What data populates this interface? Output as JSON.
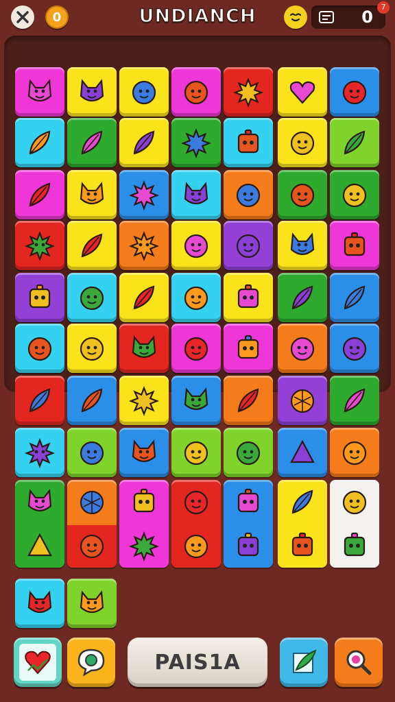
{
  "header": {
    "left_button_icon": "tools-icon",
    "coin_value": "0",
    "title": "UNDIANCH",
    "mascot_icon": "smiley-face-icon",
    "score_icon": "ticket-icon",
    "score_value": "0",
    "score_badge": "7"
  },
  "board": {
    "rows": 9,
    "columns": 7,
    "tile_colors": {
      "magenta": "#ee37d6",
      "yellow": "#fbe31c",
      "blue": "#2b8ee8",
      "red": "#e3261f",
      "cyan": "#34d2f0",
      "green": "#2eaa2e",
      "lime": "#7fd32a",
      "orange": "#f57c1a",
      "purple": "#9340d6"
    },
    "tiles": [
      [
        {
          "color": "magenta",
          "icon": "fox-icon"
        },
        {
          "color": "yellow",
          "icon": "cat-icon"
        },
        {
          "color": "yellow",
          "icon": "chat-face-icon"
        },
        {
          "color": "magenta",
          "icon": "bug-icon"
        },
        {
          "color": "red",
          "icon": "star-burst-icon"
        },
        {
          "color": "yellow",
          "icon": "heart-icon"
        },
        {
          "color": "blue",
          "icon": "smiley-icon"
        }
      ],
      [
        {
          "color": "cyan",
          "icon": "feather-icon"
        },
        {
          "color": "green",
          "icon": "bottle-icon"
        },
        {
          "color": "yellow",
          "icon": "leaf-icon"
        },
        {
          "color": "green",
          "icon": "star-icon"
        },
        {
          "color": "cyan",
          "icon": "bag-icon"
        },
        {
          "color": "yellow",
          "icon": "ball-face-icon"
        },
        {
          "color": "lime",
          "icon": "leaf-spray-icon"
        }
      ],
      [
        {
          "color": "magenta",
          "icon": "torch-icon"
        },
        {
          "color": "yellow",
          "icon": "devil-icon"
        },
        {
          "color": "blue",
          "icon": "star-icon"
        },
        {
          "color": "cyan",
          "icon": "fox-icon"
        },
        {
          "color": "orange",
          "icon": "apple-icon"
        },
        {
          "color": "green",
          "icon": "boot-icon"
        },
        {
          "color": "green",
          "icon": "onion-face-icon"
        }
      ],
      [
        {
          "color": "red",
          "icon": "virus-icon"
        },
        {
          "color": "yellow",
          "icon": "leaf-icon"
        },
        {
          "color": "orange",
          "icon": "splat-icon"
        },
        {
          "color": "yellow",
          "icon": "ghost-icon"
        },
        {
          "color": "purple",
          "icon": "octopus-icon"
        },
        {
          "color": "yellow",
          "icon": "lion-icon"
        },
        {
          "color": "magenta",
          "icon": "robot-icon"
        }
      ],
      [
        {
          "color": "purple",
          "icon": "robot-icon"
        },
        {
          "color": "cyan",
          "icon": "snail-icon"
        },
        {
          "color": "yellow",
          "icon": "broom-icon"
        },
        {
          "color": "cyan",
          "icon": "bubble-face-icon"
        },
        {
          "color": "yellow",
          "icon": "jar-icon"
        },
        {
          "color": "green",
          "icon": "leaf-icon"
        },
        {
          "color": "blue",
          "icon": "spoon-icon"
        }
      ],
      [
        {
          "color": "cyan",
          "icon": "smiley-icon"
        },
        {
          "color": "yellow",
          "icon": "fruit-icon"
        },
        {
          "color": "red",
          "icon": "frog-icon"
        },
        {
          "color": "magenta",
          "icon": "cyclops-icon"
        },
        {
          "color": "magenta",
          "icon": "phone-icon"
        },
        {
          "color": "orange",
          "icon": "berry-icon"
        },
        {
          "color": "blue",
          "icon": "spider-icon"
        }
      ],
      [
        {
          "color": "red",
          "icon": "bottle-icon"
        },
        {
          "color": "blue",
          "icon": "paintbrush-icon"
        },
        {
          "color": "yellow",
          "icon": "sun-icon"
        },
        {
          "color": "blue",
          "icon": "fox-icon"
        },
        {
          "color": "orange",
          "icon": "leaf-icon"
        },
        {
          "color": "purple",
          "icon": "waffle-icon"
        },
        {
          "color": "green",
          "icon": "broom-icon"
        }
      ],
      [
        {
          "color": "cyan",
          "icon": "virus-icon"
        },
        {
          "color": "lime",
          "icon": "face-icon"
        },
        {
          "color": "blue",
          "icon": "fox-icon"
        },
        {
          "color": "lime",
          "icon": "onion-icon"
        },
        {
          "color": "lime",
          "icon": "smiley-icon"
        },
        {
          "color": "blue",
          "icon": "bell-icon"
        },
        {
          "color": "orange",
          "icon": "cherry-icon"
        }
      ]
    ],
    "double_tiles": [
      {
        "top_color": "green",
        "bottom_color": "green",
        "top_icon": "fox-icon",
        "bottom_icon": "triangle-icon"
      },
      {
        "top_color": "orange",
        "bottom_color": "red",
        "top_icon": "globe-icon",
        "bottom_icon": "bone-icon"
      },
      {
        "top_color": "magenta",
        "bottom_color": "magenta",
        "top_icon": "camera-icon",
        "bottom_icon": "star-icon"
      },
      {
        "top_color": "red",
        "bottom_color": "red",
        "top_icon": "hand-icon",
        "bottom_icon": "smiley-icon"
      },
      {
        "top_color": "blue",
        "bottom_color": "blue",
        "top_icon": "robot-icon",
        "bottom_icon": "box-face-icon"
      },
      {
        "top_color": "yellow",
        "bottom_color": "yellow",
        "top_icon": "feather-icon",
        "bottom_icon": "lock-icon"
      },
      {
        "top_color": "white",
        "bottom_color": "white",
        "top_icon": "flower-face-icon",
        "bottom_icon": "whistle-icon"
      }
    ],
    "tray_tiles": [
      {
        "color": "cyan",
        "icon": "pig-icon"
      },
      {
        "color": "lime",
        "icon": "cat-icon"
      }
    ]
  },
  "bottom_bar": {
    "left_buttons": [
      {
        "color": "#62d6c4",
        "icon": "heart-icon"
      },
      {
        "color": "#fbb41c",
        "icon": "chat-bubble-icon"
      }
    ],
    "main_button_label": "PAIS1A",
    "right_buttons": [
      {
        "color": "#40b8e8",
        "icon": "leaf-pen-icon"
      },
      {
        "color": "#f57c1a",
        "icon": "magnifier-icon"
      }
    ]
  }
}
